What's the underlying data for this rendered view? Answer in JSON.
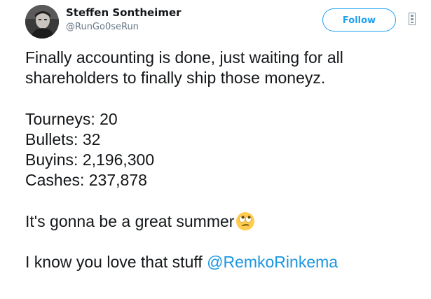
{
  "author": {
    "display_name": "Steffen Sontheimer",
    "handle": "@RunGo0seRun"
  },
  "actions": {
    "follow_label": "Follow"
  },
  "tweet": {
    "intro_line_1": "Finally accounting is done, just waiting for all",
    "intro_line_2": "shareholders to finally ship those moneyz.",
    "stats": [
      "Tourneys: 20",
      "Bullets: 32",
      "Buyins: 2,196,300",
      "Cashes: 237,878"
    ],
    "summer_text": "It's gonna be a great summer",
    "emoji": "face-with-rolling-eyes",
    "closing_text": "I know you love that stuff ",
    "mention": "@RemkoRinkema"
  },
  "colors": {
    "follow_accent": "#1da1f2",
    "mention": "#1b95e0",
    "handle_gray": "#657786"
  }
}
